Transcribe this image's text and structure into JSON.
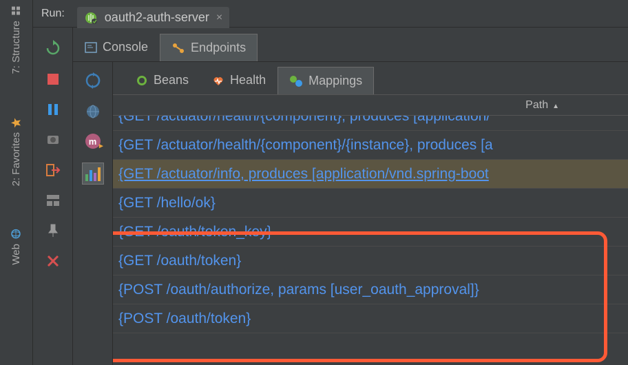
{
  "sidebars": {
    "structure": "7: Structure",
    "favorites": "2: Favorites",
    "web": "Web"
  },
  "run": {
    "label": "Run:",
    "tab": "oauth2-auth-server"
  },
  "tabs1": {
    "console": "Console",
    "endpoints": "Endpoints"
  },
  "tabs2": {
    "beans": "Beans",
    "health": "Health",
    "mappings": "Mappings"
  },
  "header": {
    "path": "Path"
  },
  "rows": [
    "{GET /actuator/health/{component}, produces [application/",
    "{GET /actuator/health/{component}/{instance}, produces [a",
    "{GET /actuator/info, produces [application/vnd.spring-boot",
    "{GET /hello/ok}",
    "{GET /oauth/token_key}",
    "{GET /oauth/token}",
    "{POST /oauth/authorize, params [user_oauth_approval]}",
    "{POST /oauth/token}"
  ]
}
